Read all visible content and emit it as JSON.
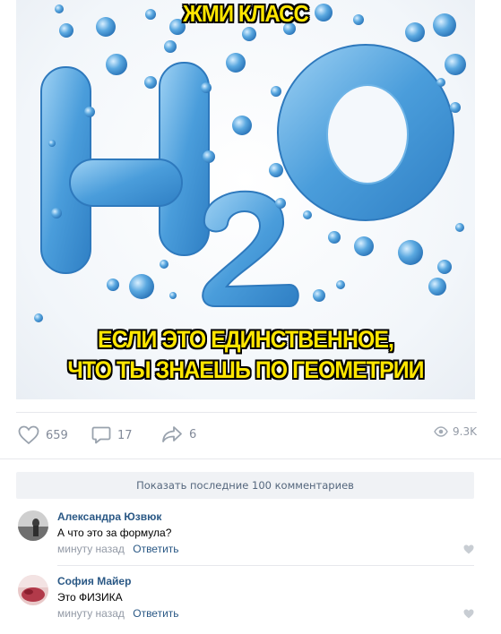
{
  "meme": {
    "top_text": "ЖМИ КЛАСС",
    "bottom_line1": "ЕСЛИ ЭТО ЕДИНСТВЕННОЕ,",
    "bottom_line2": "ЧТО ТЫ ЗНАЕШЬ ПО ГЕОМЕТРИИ",
    "formula": "H2O"
  },
  "actions": {
    "likes": "659",
    "comments": "17",
    "shares": "6",
    "views": "9.3K"
  },
  "comments_section": {
    "show_more_label": "Показать последние 100 комментариев",
    "items": [
      {
        "author": "Александра Юзвюк",
        "text": "А что это за формула?",
        "time": "минуту назад",
        "reply_label": "Ответить"
      },
      {
        "author": "София Майер",
        "text": "Это ФИЗИКА",
        "time": "минуту назад",
        "reply_label": "Ответить"
      }
    ]
  },
  "colors": {
    "meme_text": "#ffe600",
    "water": "#5aa8e0",
    "link": "#2a5885",
    "meta": "#939aa6"
  }
}
